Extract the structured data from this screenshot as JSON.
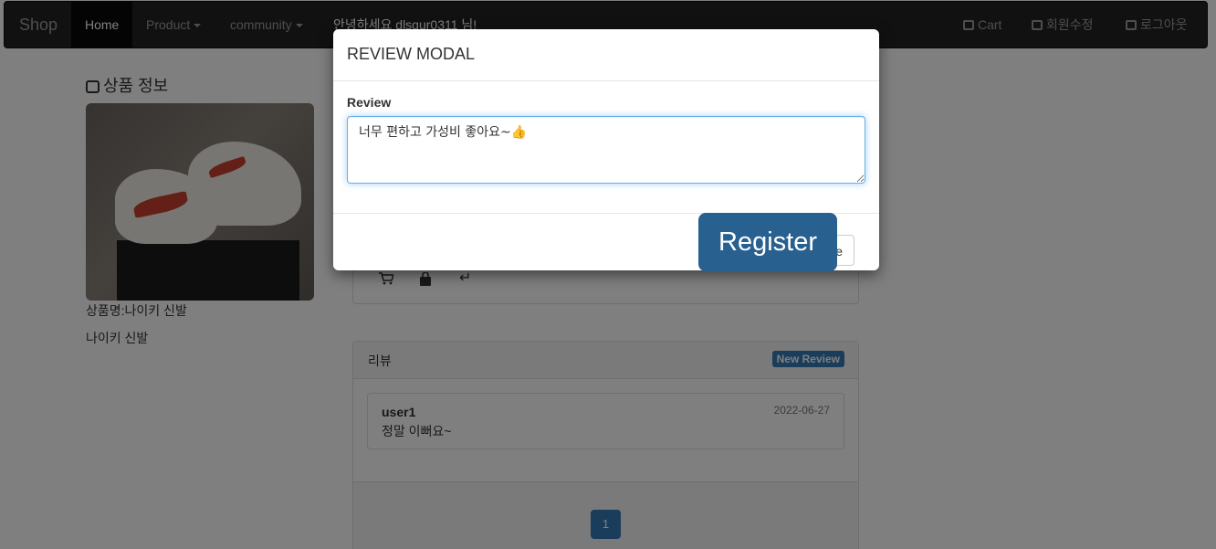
{
  "navbar": {
    "brand": "Shop",
    "home": "Home",
    "product": "Product",
    "community": "community",
    "greeting": "안녕하세요 dlsgur0311 님!",
    "cart": "Cart",
    "edit_profile": "회원수정",
    "logout": "로그아웃"
  },
  "product": {
    "section_title": "상품 정보",
    "name": "상품명:나이키 신발",
    "description": "나이키 신발"
  },
  "actions": {
    "cart_icon": "cart-icon",
    "bag_icon": "bag-icon",
    "back_icon": "return-icon",
    "back_glyph": "↵"
  },
  "reviews": {
    "heading": "리뷰",
    "new_review": "New Review",
    "items": [
      {
        "user": "user1",
        "date": "2022-06-27",
        "text": "정말 이뻐요~"
      }
    ],
    "page": "1"
  },
  "modal": {
    "title": "REVIEW MODAL",
    "field_label": "Review",
    "review_value": "너무 편하고 가성비 좋아요~👍",
    "register": "Register",
    "close": "Close"
  },
  "colors": {
    "primary": "#337ab7",
    "primary_dark": "#286090",
    "navbar": "#222222"
  }
}
